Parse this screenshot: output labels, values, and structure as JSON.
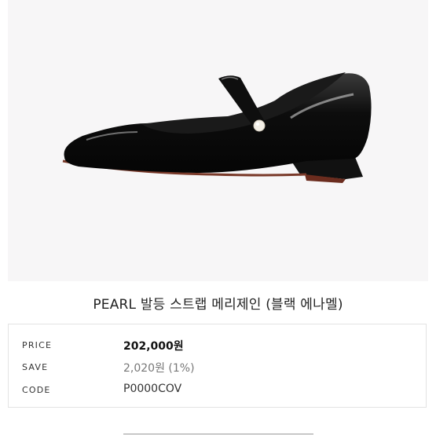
{
  "product": {
    "title": "PEARL 발등 스트랩 메리제인 (블랙 에나멜)",
    "image_alt": "black patent mary jane flat with pearl strap"
  },
  "info": [
    {
      "label": "PRICE",
      "value": "202,000원"
    },
    {
      "label": "SAVE",
      "value": "2,020원 (1%)"
    },
    {
      "label": "CODE",
      "value": "P0000COV"
    }
  ],
  "colors": {
    "image_bg": "#f7f6f7",
    "shoe": "#0b0b0b",
    "border": "#e3e3e3"
  }
}
